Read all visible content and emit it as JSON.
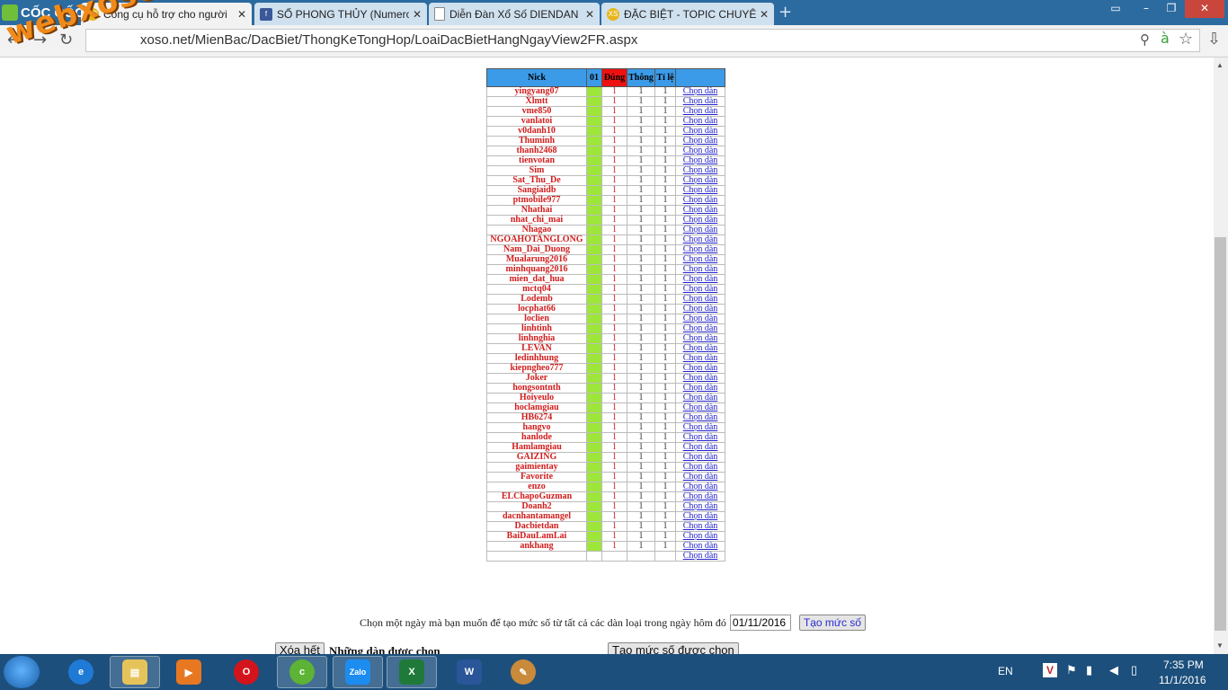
{
  "browser": {
    "brand": "CỐC CỐC",
    "tabs": [
      {
        "title": "Công cụ hỗ trợ cho người",
        "icon": "xs-icon",
        "active": true
      },
      {
        "title": "SỐ PHONG THỦY (Numero",
        "icon": "facebook-icon",
        "active": false
      },
      {
        "title": "Diễn Đàn Xổ Số DIENDAN",
        "icon": "page-icon",
        "active": false
      },
      {
        "title": "ĐẶC BIỆT - TOPIC CHUYÊN",
        "icon": "xs-icon",
        "active": false
      }
    ],
    "url_host": "xoso.net",
    "url_path": "/MienBac/DacBiet/ThongKeTongHop/LoaiDacBietHangNgayView2FR.aspx",
    "watermark": "webxoso.net"
  },
  "table": {
    "headers": {
      "nick": "Nick",
      "c01": "01",
      "dung": "Đúng",
      "thong": "Thông",
      "tile": "Tỉ lệ"
    },
    "link_label": "Chọn dàn",
    "rows": [
      {
        "nick": "yingyang07",
        "dung": "1",
        "thong": "1",
        "tile": "1"
      },
      {
        "nick": "Xlmtt",
        "dung": "1",
        "thong": "1",
        "tile": "1"
      },
      {
        "nick": "vme850",
        "dung": "1",
        "thong": "1",
        "tile": "1"
      },
      {
        "nick": "vanlatoi",
        "dung": "1",
        "thong": "1",
        "tile": "1"
      },
      {
        "nick": "v0danh10",
        "dung": "1",
        "thong": "1",
        "tile": "1"
      },
      {
        "nick": "Thuminh",
        "dung": "1",
        "thong": "1",
        "tile": "1"
      },
      {
        "nick": "thanh2468",
        "dung": "1",
        "thong": "1",
        "tile": "1"
      },
      {
        "nick": "tienvotan",
        "dung": "1",
        "thong": "1",
        "tile": "1"
      },
      {
        "nick": "Sim",
        "dung": "1",
        "thong": "1",
        "tile": "1"
      },
      {
        "nick": "Sat_Thu_De",
        "dung": "1",
        "thong": "1",
        "tile": "1"
      },
      {
        "nick": "Sangiaidb",
        "dung": "1",
        "thong": "1",
        "tile": "1"
      },
      {
        "nick": "ptmobile977",
        "dung": "1",
        "thong": "1",
        "tile": "1"
      },
      {
        "nick": "Nhathai",
        "dung": "1",
        "thong": "1",
        "tile": "1"
      },
      {
        "nick": "nhat_chi_mai",
        "dung": "1",
        "thong": "1",
        "tile": "1"
      },
      {
        "nick": "Nhagao",
        "dung": "1",
        "thong": "1",
        "tile": "1"
      },
      {
        "nick": "NGOAHOTANGLONG",
        "dung": "1",
        "thong": "1",
        "tile": "1"
      },
      {
        "nick": "Nam_Dai_Duong",
        "dung": "1",
        "thong": "1",
        "tile": "1"
      },
      {
        "nick": "Mualarung2016",
        "dung": "1",
        "thong": "1",
        "tile": "1"
      },
      {
        "nick": "minhquang2016",
        "dung": "1",
        "thong": "1",
        "tile": "1"
      },
      {
        "nick": "mien_dat_hua",
        "dung": "1",
        "thong": "1",
        "tile": "1"
      },
      {
        "nick": "mctq04",
        "dung": "1",
        "thong": "1",
        "tile": "1"
      },
      {
        "nick": "Lodemb",
        "dung": "1",
        "thong": "1",
        "tile": "1"
      },
      {
        "nick": "locphat66",
        "dung": "1",
        "thong": "1",
        "tile": "1"
      },
      {
        "nick": "loclien",
        "dung": "1",
        "thong": "1",
        "tile": "1"
      },
      {
        "nick": "linhtinh",
        "dung": "1",
        "thong": "1",
        "tile": "1"
      },
      {
        "nick": "linhnghia",
        "dung": "1",
        "thong": "1",
        "tile": "1"
      },
      {
        "nick": "LEVAN",
        "dung": "1",
        "thong": "1",
        "tile": "1"
      },
      {
        "nick": "ledinhhung",
        "dung": "1",
        "thong": "1",
        "tile": "1"
      },
      {
        "nick": "kiepngheo777",
        "dung": "1",
        "thong": "1",
        "tile": "1"
      },
      {
        "nick": "Joker",
        "dung": "1",
        "thong": "1",
        "tile": "1"
      },
      {
        "nick": "hongsontnth",
        "dung": "1",
        "thong": "1",
        "tile": "1"
      },
      {
        "nick": "Hoiyeulo",
        "dung": "1",
        "thong": "1",
        "tile": "1"
      },
      {
        "nick": "hoclamgiau",
        "dung": "1",
        "thong": "1",
        "tile": "1"
      },
      {
        "nick": "HB6274",
        "dung": "1",
        "thong": "1",
        "tile": "1"
      },
      {
        "nick": "hangvo",
        "dung": "1",
        "thong": "1",
        "tile": "1"
      },
      {
        "nick": "hanlode",
        "dung": "1",
        "thong": "1",
        "tile": "1"
      },
      {
        "nick": "Hamlamgiau",
        "dung": "1",
        "thong": "1",
        "tile": "1"
      },
      {
        "nick": "GAIZING",
        "dung": "1",
        "thong": "1",
        "tile": "1"
      },
      {
        "nick": "gaimientay",
        "dung": "1",
        "thong": "1",
        "tile": "1"
      },
      {
        "nick": "Favorite",
        "dung": "1",
        "thong": "1",
        "tile": "1"
      },
      {
        "nick": "enzo",
        "dung": "1",
        "thong": "1",
        "tile": "1"
      },
      {
        "nick": "ELChapoGuzman",
        "dung": "1",
        "thong": "1",
        "tile": "1"
      },
      {
        "nick": "Doanh2",
        "dung": "1",
        "thong": "1",
        "tile": "1"
      },
      {
        "nick": "dacnhantamangel",
        "dung": "1",
        "thong": "1",
        "tile": "1"
      },
      {
        "nick": "Dacbietdan",
        "dung": "1",
        "thong": "1",
        "tile": "1"
      },
      {
        "nick": "BaiDauLamLai",
        "dung": "1",
        "thong": "1",
        "tile": "1"
      },
      {
        "nick": "ankhang",
        "dung": "1",
        "thong": "1",
        "tile": "1"
      },
      {
        "nick": "",
        "dung": "",
        "thong": "",
        "tile": ""
      }
    ]
  },
  "form": {
    "prompt": "Chọn một ngày mà bạn muốn để tạo mức số từ tất cả các dàn loại trong ngày hôm đó",
    "date_value": "01/11/2016",
    "create_button": "Tạo mức số",
    "clear_button": "Xóa hết",
    "selected_label": "Những dàn được chọn",
    "create_selected_button": "Tạo mức số được chọn"
  },
  "taskbar": {
    "apps": [
      "Internet Explorer",
      "File Explorer",
      "Media",
      "Opera",
      "Cốc Cốc",
      "Zalo",
      "Excel",
      "Word",
      "Paint"
    ],
    "lang": "EN",
    "time": "7:35 PM",
    "date": "11/1/2016"
  }
}
